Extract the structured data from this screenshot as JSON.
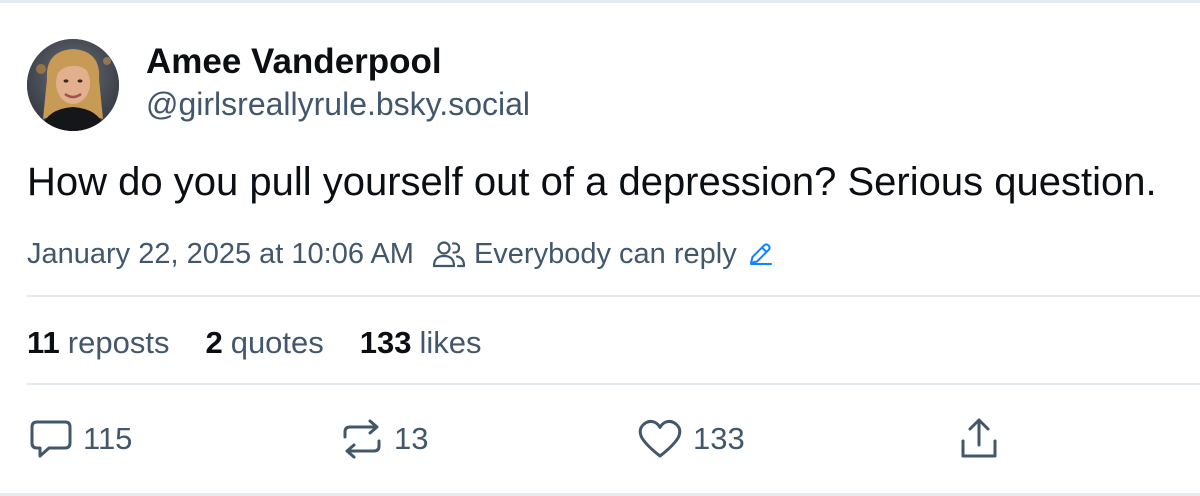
{
  "author": {
    "display_name": "Amee Vanderpool",
    "handle": "@girlsreallyrule.bsky.social",
    "avatar_icon": "profile-photo"
  },
  "post": {
    "text": "How do you pull yourself out of a depression? Serious question.",
    "timestamp": "January 22, 2025 at 10:06 AM",
    "reply_setting": "Everybody can reply"
  },
  "stats": {
    "reposts_count": "11",
    "reposts_label": "reposts",
    "quotes_count": "2",
    "quotes_label": "quotes",
    "likes_count": "133",
    "likes_label": "likes"
  },
  "actions": {
    "reply_count": "115",
    "repost_count": "13",
    "like_count": "133",
    "reply_icon": "speech-bubble-icon",
    "repost_icon": "repost-arrows-icon",
    "like_icon": "heart-icon",
    "share_icon": "share-upload-icon"
  },
  "colors": {
    "text_primary": "#0b0f14",
    "text_secondary": "#42576c",
    "accent_blue": "#1083fe",
    "divider": "#e6ebf0"
  }
}
